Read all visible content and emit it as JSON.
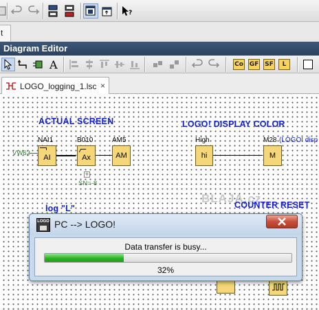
{
  "app": {
    "top_tab_stub": "t"
  },
  "editor": {
    "header_title": "Diagram Editor",
    "function_buttons": [
      "Co",
      "GF",
      "SF",
      "L"
    ]
  },
  "file_tab": {
    "label": "LOGO_logging_1.lsc",
    "close_glyph": "×"
  },
  "canvas": {
    "headings": {
      "actual_screen": "ACTUAL SCREEN",
      "logo_display_color": "LOGO! DISPLAY COLOR",
      "counter_reset": "COUNTER RESET",
      "log_l": "log \"L\""
    },
    "watermark": "BLAJA.cz",
    "blocks": {
      "nai1": {
        "label": "NAI1",
        "symbol": "AI"
      },
      "b010": {
        "label": "B010",
        "symbol": "Ax"
      },
      "am5": {
        "label": "AM5",
        "symbol": "AM"
      },
      "high": {
        "label": "High",
        "symbol": "hi"
      },
      "m28": {
        "label": "M28",
        "symbol": "M",
        "comment": "(LOGO! disp"
      }
    },
    "input_tag": "VW62",
    "param_text": "SN=-8"
  },
  "dialog": {
    "title": "PC --> LOGO!",
    "icon_text": "LOGO",
    "message": "Data transfer is busy...",
    "progress_percent": 32,
    "percent_label": "32%"
  },
  "colors": {
    "heading_blue": "#1020d8",
    "block_yellow": "#f5d77a",
    "progress_green": "#28b428",
    "title_bar_navy": "#2b4260"
  }
}
